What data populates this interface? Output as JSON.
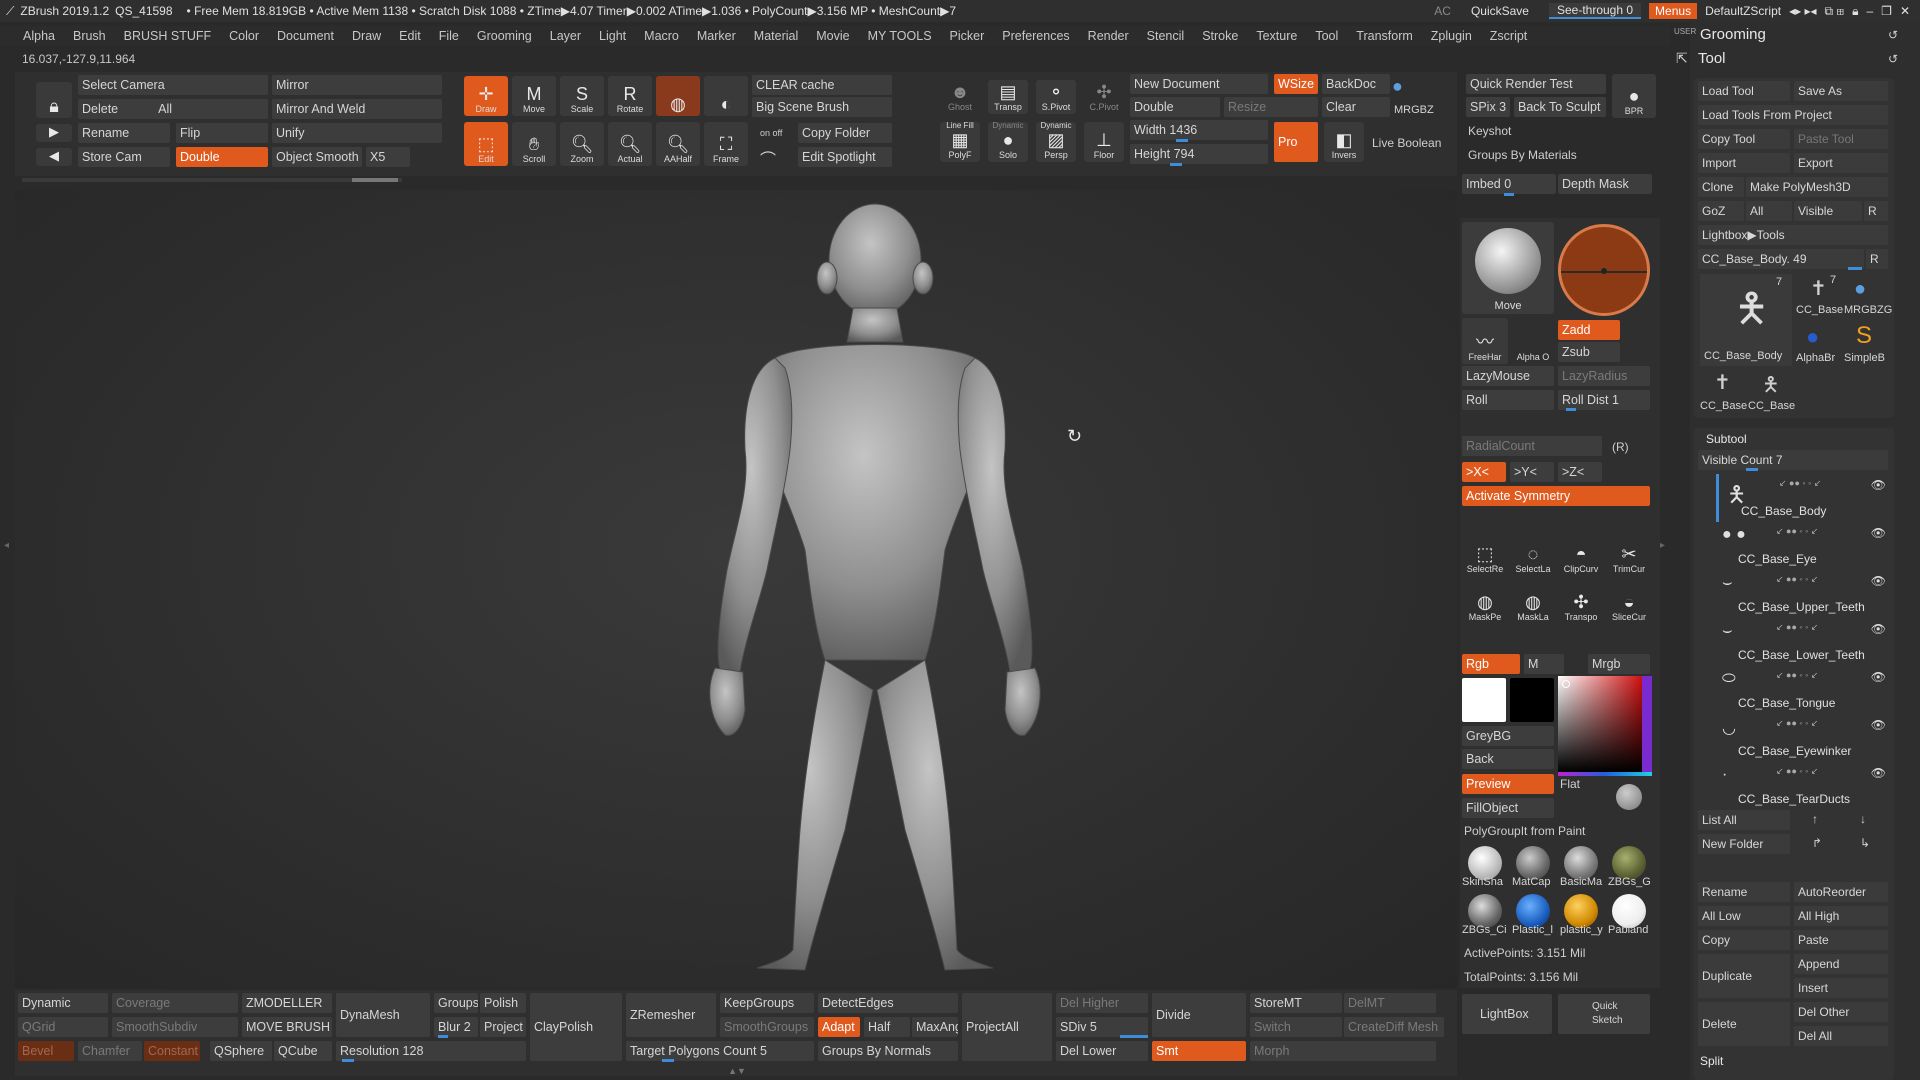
{
  "titlebar": {
    "app": "ZBrush 2019.1.2",
    "qs": "QS_41598",
    "stats": "• Free Mem 18.819GB • Active Mem 1138 • Scratch Disk 1088 • ZTime▶4.07 Timer▶0.002 ATime▶1.036 • PolyCount▶3.156 MP • MeshCount▶7",
    "ac": "AC",
    "quicksave": "QuickSave",
    "seethrough": "See-through  0",
    "menus": "Menus",
    "script": "DefaultZScript"
  },
  "menubar": [
    "Alpha",
    "Brush",
    "BRUSH STUFF",
    "Color",
    "Document",
    "Draw",
    "Edit",
    "File",
    "Grooming",
    "Layer",
    "Light",
    "Macro",
    "Marker",
    "Material",
    "Movie",
    "MY TOOLS",
    "Picker",
    "Preferences",
    "Render",
    "Stencil",
    "Stroke",
    "Texture",
    "Tool",
    "Transform",
    "Zplugin",
    "Zscript"
  ],
  "coords": "16.037,-127.9,11.964",
  "top_left": {
    "select_camera": "Select Camera",
    "delete": "Delete",
    "all": "All",
    "rename": "Rename",
    "store_cam": "Store Cam",
    "double": "Double",
    "mirror": "Mirror",
    "mirror_weld": "Mirror And Weld",
    "flip": "Flip",
    "unify": "Unify",
    "object_smooth": "Object Smooth",
    "x5": "X5"
  },
  "tools": {
    "draw": "Draw",
    "move": "Move",
    "scale": "Scale",
    "rotate": "Rotate",
    "edit": "Edit",
    "scroll": "Scroll",
    "zoom": "Zoom",
    "actual": "Actual",
    "aahalf": "AAHalf",
    "frame": "Frame",
    "clear_cache": "CLEAR cache",
    "big_scene": "Big Scene Brush",
    "copy_folder": "Copy Folder",
    "edit_spotlight": "Edit Spotlight",
    "onoff": "on  off",
    "ghost": "Ghost",
    "transp": "Transp",
    "spivot": "S.Pivot",
    "cpivot": "C.Pivot",
    "linefill": "Line Fill",
    "polyf": "PolyF",
    "dynamic": "Dynamic",
    "solo": "Solo",
    "persp": "Persp",
    "floor": "Floor"
  },
  "document": {
    "new_document": "New Document",
    "wsize": "WSize",
    "backdoc": "BackDoc",
    "double": "Double",
    "resize": "Resize",
    "clear": "Clear",
    "width": "Width 1436",
    "height": "Height 794",
    "pro": "Pro",
    "invers": "Invers",
    "live_boolean": "Live Boolean",
    "mrgbz": "MRGBZ"
  },
  "render": {
    "quick_render": "Quick Render Test",
    "bpr": "BPR",
    "spix": "SPix 3",
    "back_to_sculpt": "Back To Sculpt",
    "keyshot": "Keyshot",
    "groups_by_materials": "Groups By Materials",
    "imbed": "Imbed 0",
    "depth_mask": "Depth Mask"
  },
  "brushpanel": {
    "move": "Move",
    "freehand": "FreeHar",
    "alpha": "Alpha O",
    "zadd": "Zadd",
    "zsub": "Zsub",
    "lazymouse": "LazyMouse",
    "lazyradius": "LazyRadius",
    "roll": "Roll",
    "rolldist": "Roll Dist 1",
    "radialcount": "RadialCount",
    "r": "(R)",
    "symx": ">X<",
    "symy": ">Y<",
    "symz": ">Z<",
    "activate_symmetry": "Activate Symmetry",
    "selectre": "SelectRe",
    "selectla": "SelectLa",
    "clipcurv": "ClipCurv",
    "trimcur": "TrimCur",
    "maskpe": "MaskPe",
    "maskla": "MaskLa",
    "transpo": "Transpo",
    "slicecur": "SliceCur"
  },
  "colorpanel": {
    "rgb": "Rgb",
    "m": "M",
    "mrgb": "Mrgb",
    "greybg": "GreyBG",
    "back": "Back",
    "preview": "Preview",
    "flat": "Flat",
    "fillobject": "FillObject",
    "polygroupit": "PolyGroupIt from Paint",
    "materials": [
      "SkinSha",
      "MatCap",
      "BasicMa",
      "ZBGs_G",
      "ZBGs_Ci",
      "Plastic_l",
      "plastic_y",
      "Pabland"
    ],
    "active_points": "ActivePoints: 3.151 Mil",
    "total_points": "TotalPoints: 3.156 Mil",
    "lightbox": "LightBox",
    "quick_sketch": "Quick Sketch"
  },
  "bottom": {
    "dynamic": "Dynamic",
    "coverage": "Coverage",
    "zmodeller": "ZMODELLER",
    "dynamesh": "DynaMesh",
    "groups": "Groups",
    "polish": "Polish",
    "zremesher": "ZRemesher",
    "keepgroups": "KeepGroups",
    "detectedges": "DetectEdges",
    "qgrid": "QGrid",
    "smoothsubdiv": "SmoothSubdiv",
    "movebrush": "MOVE BRUSH",
    "blur": "Blur 2",
    "project": "Project",
    "claypolish": "ClayPolish",
    "smoothgroups": "SmoothGroups",
    "adapt": "Adapt",
    "half": "Half",
    "maxang": "MaxAng",
    "projectall": "ProjectAll",
    "delhigher": "Del Higher",
    "divide": "Divide",
    "storemt": "StoreMT",
    "delmt": "DelMT",
    "bevel": "Bevel",
    "chamfer": "Chamfer",
    "constant": "Constant",
    "qsphere": "QSphere",
    "qcube": "QCube",
    "resolution": "Resolution 128",
    "target_polys": "Target Polygons Count 5",
    "groups_by_normals": "Groups By Normals",
    "sdiv": "SDiv 5",
    "dellower": "Del Lower",
    "smt": "Smt",
    "switch": "Switch",
    "creatediff": "CreateDiff Mesh",
    "morph": "Morph"
  },
  "rightdock": {
    "header": "Grooming",
    "user": "USER",
    "tool": "Tool",
    "load_tool": "Load Tool",
    "save_as": "Save As",
    "load_from_project": "Load Tools From Project",
    "copy_tool": "Copy Tool",
    "paste_tool": "Paste Tool",
    "import": "Import",
    "export": "Export",
    "clone": "Clone",
    "make_polymesh": "Make PolyMesh3D",
    "goz": "GoZ",
    "all": "All",
    "visible": "Visible",
    "r": "R",
    "lightbox_tools": "Lightbox▶Tools",
    "current_tool": "CC_Base_Body. 49",
    "thumbs": [
      "CC_Base_Body",
      "CC_Base",
      "MRGBZG",
      "AlphaBr",
      "SimpleB",
      "CC_Base",
      "CC_Base"
    ],
    "thumb_counts": [
      "7",
      "7"
    ],
    "subtool": "Subtool",
    "visible_count": "Visible Count 7",
    "subtools": [
      "CC_Base_Body",
      "CC_Base_Eye",
      "CC_Base_Upper_Teeth",
      "CC_Base_Lower_Teeth",
      "CC_Base_Tongue",
      "CC_Base_Eyewinker",
      "CC_Base_TearDucts"
    ],
    "list_all": "List All",
    "new_folder": "New Folder",
    "rename": "Rename",
    "autoreorder": "AutoReorder",
    "all_low": "All Low",
    "all_high": "All High",
    "copy": "Copy",
    "paste": "Paste",
    "duplicate": "Duplicate",
    "append": "Append",
    "insert": "Insert",
    "delete": "Delete",
    "del_other": "Del Other",
    "del_all": "Del All",
    "split": "Split"
  },
  "colors": {
    "accent": "#e05a1e",
    "panel": "#353535",
    "bg": "#2a2a2a",
    "slider": "#3e8dd8"
  }
}
